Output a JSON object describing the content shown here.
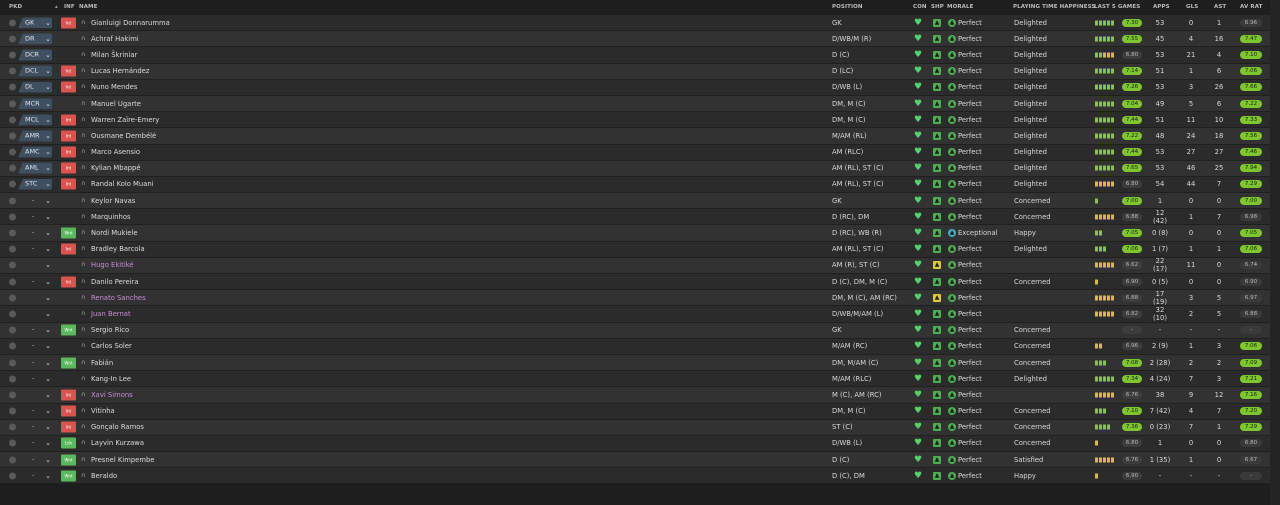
{
  "headers": {
    "pkd": "PKD",
    "inf": "INF",
    "name": "NAME",
    "position": "POSITION",
    "con": "CON",
    "shp": "SHP",
    "morale": "MORALE",
    "pth": "PLAYING TIME HAPPINESS",
    "last5": "LAST 5 GAMES",
    "apps": "APPS",
    "gls": "GLS",
    "ast": "AST",
    "avrat": "AV RAT"
  },
  "players": [
    {
      "pos_tag": "GK",
      "inf": "Int",
      "name": "Gianluigi Donnarumma",
      "position": "GK",
      "morale": "Perfect",
      "pth": "Delighted",
      "form": [
        "g",
        "g",
        "g",
        "g",
        "g"
      ],
      "rating": "7.30",
      "apps": "53",
      "gls": "0",
      "ast": "1",
      "avrat": "6.96"
    },
    {
      "pos_tag": "DR",
      "inf": "",
      "name": "Achraf Hakimi",
      "position": "D/WB/M (R)",
      "morale": "Perfect",
      "pth": "Delighted",
      "form": [
        "g",
        "g",
        "g",
        "g",
        "g"
      ],
      "rating": "7.55",
      "apps": "45",
      "gls": "4",
      "ast": "16",
      "avrat": "7.47"
    },
    {
      "pos_tag": "DCR",
      "inf": "",
      "name": "Milan Škriniar",
      "position": "D (C)",
      "morale": "Perfect",
      "pth": "Delighted",
      "form": [
        "g",
        "g",
        "y",
        "y",
        "y"
      ],
      "rating": "6.80",
      "apps": "53",
      "gls": "21",
      "ast": "4",
      "avrat": "7.10"
    },
    {
      "pos_tag": "DCL",
      "inf": "Int",
      "name": "Lucas Hernández",
      "position": "D (LC)",
      "morale": "Perfect",
      "pth": "Delighted",
      "form": [
        "g",
        "g",
        "g",
        "g",
        "g"
      ],
      "rating": "7.14",
      "apps": "51",
      "gls": "1",
      "ast": "6",
      "avrat": "7.06"
    },
    {
      "pos_tag": "DL",
      "inf": "Int",
      "name": "Nuno Mendes",
      "position": "D/WB (L)",
      "morale": "Perfect",
      "pth": "Delighted",
      "form": [
        "g",
        "g",
        "g",
        "g",
        "g"
      ],
      "rating": "7.26",
      "apps": "53",
      "gls": "3",
      "ast": "26",
      "avrat": "7.66"
    },
    {
      "pos_tag": "MCR",
      "inf": "",
      "name": "Manuel Ugarte",
      "position": "DM, M (C)",
      "morale": "Perfect",
      "pth": "Delighted",
      "form": [
        "g",
        "g",
        "g",
        "g",
        "g"
      ],
      "rating": "7.04",
      "apps": "49",
      "gls": "5",
      "ast": "6",
      "avrat": "7.22"
    },
    {
      "pos_tag": "MCL",
      "inf": "Int",
      "name": "Warren Zaïre-Emery",
      "position": "DM, M (C)",
      "morale": "Perfect",
      "pth": "Delighted",
      "form": [
        "g",
        "g",
        "g",
        "g",
        "g"
      ],
      "rating": "7.44",
      "apps": "51",
      "gls": "11",
      "ast": "10",
      "avrat": "7.33"
    },
    {
      "pos_tag": "AMR",
      "inf": "Int",
      "name": "Ousmane Dembélé",
      "position": "M/AM (RL)",
      "morale": "Perfect",
      "pth": "Delighted",
      "form": [
        "g",
        "g",
        "g",
        "g",
        "g"
      ],
      "rating": "7.22",
      "apps": "48",
      "gls": "24",
      "ast": "18",
      "avrat": "7.56"
    },
    {
      "pos_tag": "AMC",
      "inf": "Int",
      "name": "Marco Asensio",
      "position": "AM (RLC)",
      "morale": "Perfect",
      "pth": "Delighted",
      "form": [
        "g",
        "g",
        "g",
        "g",
        "g"
      ],
      "rating": "7.44",
      "apps": "53",
      "gls": "27",
      "ast": "27",
      "avrat": "7.46"
    },
    {
      "pos_tag": "AML",
      "inf": "Int",
      "name": "Kylian Mbappé",
      "position": "AM (RL), ST (C)",
      "morale": "Perfect",
      "pth": "Delighted",
      "form": [
        "g",
        "g",
        "g",
        "g",
        "g"
      ],
      "rating": "7.65",
      "apps": "53",
      "gls": "46",
      "ast": "25",
      "avrat": "7.94"
    },
    {
      "pos_tag": "STC",
      "inf": "Int",
      "name": "Randal Kolo Muani",
      "position": "AM (RL), ST (C)",
      "morale": "Perfect",
      "pth": "Delighted",
      "form": [
        "y",
        "y",
        "y",
        "y",
        "y"
      ],
      "rating": "6.80",
      "apps": "54",
      "gls": "44",
      "ast": "7",
      "avrat": "7.29"
    },
    {
      "pos_tag": "-",
      "inf": "",
      "name": "Keylor Navas",
      "position": "GK",
      "morale": "Perfect",
      "pth": "Concerned",
      "form": [
        "g"
      ],
      "rating": "7.00",
      "apps": "1",
      "gls": "0",
      "ast": "0",
      "avrat": "7.00"
    },
    {
      "pos_tag": "-",
      "inf": "",
      "name": "Marquinhos",
      "position": "D (RC), DM",
      "morale": "Perfect",
      "pth": "Concerned",
      "form": [
        "y",
        "y",
        "y",
        "y",
        "y"
      ],
      "rating": "6.88",
      "apps": "12 (42)",
      "gls": "1",
      "ast": "7",
      "avrat": "6.98"
    },
    {
      "pos_tag": "-",
      "inf": "Wnt",
      "name": "Nordi Mukiele",
      "position": "D (RC), WB (R)",
      "morale": "Exceptional",
      "pth": "Happy",
      "form": [
        "g",
        "g"
      ],
      "rating": "7.05",
      "apps": "0 (8)",
      "gls": "0",
      "ast": "0",
      "avrat": "7.05"
    },
    {
      "pos_tag": "-",
      "inf": "Int",
      "name": "Bradley Barcola",
      "position": "AM (RL), ST (C)",
      "morale": "Perfect",
      "pth": "Delighted",
      "form": [
        "g",
        "g",
        "g"
      ],
      "rating": "7.06",
      "apps": "1 (7)",
      "gls": "1",
      "ast": "1",
      "avrat": "7.06"
    },
    {
      "pos_tag": "",
      "inf": "",
      "name": "Hugo Ekitiké",
      "position": "AM (R), ST (C)",
      "morale": "Perfect",
      "pth": "",
      "form": [
        "y",
        "y",
        "y",
        "y",
        "y"
      ],
      "rating": "6.62",
      "apps": "22 (17)",
      "gls": "11",
      "ast": "0",
      "avrat": "6.74"
    },
    {
      "pos_tag": "-",
      "inf": "Int",
      "name": "Danilo Pereira",
      "position": "D (C), DM, M (C)",
      "morale": "Perfect",
      "pth": "Concerned",
      "form": [
        "y"
      ],
      "rating": "6.90",
      "apps": "0 (5)",
      "gls": "0",
      "ast": "0",
      "avrat": "6.90"
    },
    {
      "pos_tag": "",
      "inf": "",
      "name": "Renato Sanches",
      "position": "DM, M (C), AM (RC)",
      "morale": "Perfect",
      "pth": "",
      "form": [
        "y",
        "y",
        "y",
        "y",
        "y"
      ],
      "rating": "6.88",
      "apps": "17 (19)",
      "gls": "3",
      "ast": "5",
      "avrat": "6.97"
    },
    {
      "pos_tag": "",
      "inf": "",
      "name": "Juan Bernat",
      "position": "D/WB/M/AM (L)",
      "morale": "Perfect",
      "pth": "",
      "form": [
        "y",
        "y",
        "y",
        "y",
        "y"
      ],
      "rating": "6.82",
      "apps": "32 (10)",
      "gls": "2",
      "ast": "5",
      "avrat": "6.88"
    },
    {
      "pos_tag": "-",
      "inf": "Wnt",
      "name": "Sergio Rico",
      "position": "GK",
      "morale": "Perfect",
      "pth": "Concerned",
      "form": [],
      "rating": "-",
      "apps": "-",
      "gls": "-",
      "ast": "-",
      "avrat": "-"
    },
    {
      "pos_tag": "-",
      "inf": "",
      "name": "Carlos Soler",
      "position": "M/AM (RC)",
      "morale": "Perfect",
      "pth": "Concerned",
      "form": [
        "y",
        "y"
      ],
      "rating": "6.96",
      "apps": "2 (9)",
      "gls": "1",
      "ast": "3",
      "avrat": "7.06"
    },
    {
      "pos_tag": "-",
      "inf": "Wnt",
      "name": "Fabián",
      "position": "DM, M/AM (C)",
      "morale": "Perfect",
      "pth": "Concerned",
      "form": [
        "g",
        "g",
        "g"
      ],
      "rating": "7.08",
      "apps": "2 (28)",
      "gls": "2",
      "ast": "2",
      "avrat": "7.09"
    },
    {
      "pos_tag": "-",
      "inf": "",
      "name": "Kang-In Lee",
      "position": "M/AM (RLC)",
      "morale": "Perfect",
      "pth": "Delighted",
      "form": [
        "g",
        "g",
        "g",
        "g",
        "g"
      ],
      "rating": "7.34",
      "apps": "4 (24)",
      "gls": "7",
      "ast": "3",
      "avrat": "7.21"
    },
    {
      "pos_tag": "",
      "inf": "Int",
      "name": "Xavi Simons",
      "position": "M (C), AM (RC)",
      "morale": "Perfect",
      "pth": "",
      "form": [
        "y",
        "y",
        "y",
        "y",
        "y"
      ],
      "rating": "6.76",
      "apps": "38",
      "gls": "9",
      "ast": "12",
      "avrat": "7.16"
    },
    {
      "pos_tag": "-",
      "inf": "Int",
      "name": "Vitinha",
      "position": "DM, M (C)",
      "morale": "Perfect",
      "pth": "Concerned",
      "form": [
        "g",
        "g",
        "g"
      ],
      "rating": "7.10",
      "apps": "7 (42)",
      "gls": "4",
      "ast": "7",
      "avrat": "7.20"
    },
    {
      "pos_tag": "-",
      "inf": "Int",
      "name": "Gonçalo Ramos",
      "position": "ST (C)",
      "morale": "Perfect",
      "pth": "Concerned",
      "form": [
        "g",
        "g",
        "g",
        "g"
      ],
      "rating": "7.36",
      "apps": "0 (23)",
      "gls": "7",
      "ast": "1",
      "avrat": "7.29"
    },
    {
      "pos_tag": "-",
      "inf": "Ldn",
      "name": "Layvin Kurzawa",
      "position": "D/WB (L)",
      "morale": "Perfect",
      "pth": "Concerned",
      "form": [
        "y"
      ],
      "rating": "6.80",
      "apps": "1",
      "gls": "0",
      "ast": "0",
      "avrat": "6.80"
    },
    {
      "pos_tag": "-",
      "inf": "Wnt",
      "name": "Presnel Kimpembe",
      "position": "D (C)",
      "morale": "Perfect",
      "pth": "Satisfied",
      "form": [
        "y",
        "y",
        "y",
        "y",
        "y"
      ],
      "rating": "6.76",
      "apps": "1 (35)",
      "gls": "1",
      "ast": "0",
      "avrat": "6.67"
    },
    {
      "pos_tag": "-",
      "inf": "Wnt",
      "name": "Beraldo",
      "position": "D (C), DM",
      "morale": "Perfect",
      "pth": "Happy",
      "form": [
        "y"
      ],
      "rating": "6.90",
      "apps": "-",
      "gls": "-",
      "ast": "-",
      "avrat": "-"
    }
  ]
}
